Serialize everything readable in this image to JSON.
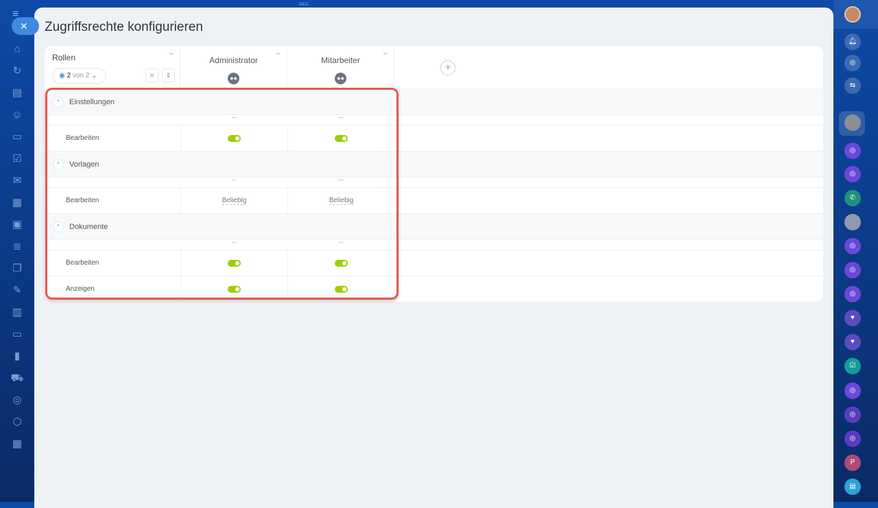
{
  "page_title": "Zugriffsrechte konfigurieren",
  "top_label": "NEU",
  "roles_header": {
    "label": "Rollen",
    "visible_count": "2",
    "visible_of": "von 2"
  },
  "roles": [
    {
      "name": "Administrator"
    },
    {
      "name": "Mitarbeiter"
    }
  ],
  "sections": [
    {
      "label": "Einstellungen",
      "items": [
        {
          "label": "Bearbeiten",
          "values": [
            "on",
            "on"
          ]
        }
      ]
    },
    {
      "label": "Vorlagen",
      "items": [
        {
          "label": "Bearbeiten",
          "values": [
            "Beliebig",
            "Beliebig"
          ]
        }
      ]
    },
    {
      "label": "Dokumente",
      "items": [
        {
          "label": "Bearbeiten",
          "values": [
            "on",
            "on"
          ]
        },
        {
          "label": "Anzeigen",
          "values": [
            "on",
            "on"
          ]
        }
      ]
    }
  ],
  "right_sidebar": {
    "avatar_p": "P"
  },
  "colors": {
    "accent": "#3f8ae0",
    "toggle_on": "#9dcf00",
    "highlight": "#e8584e"
  }
}
